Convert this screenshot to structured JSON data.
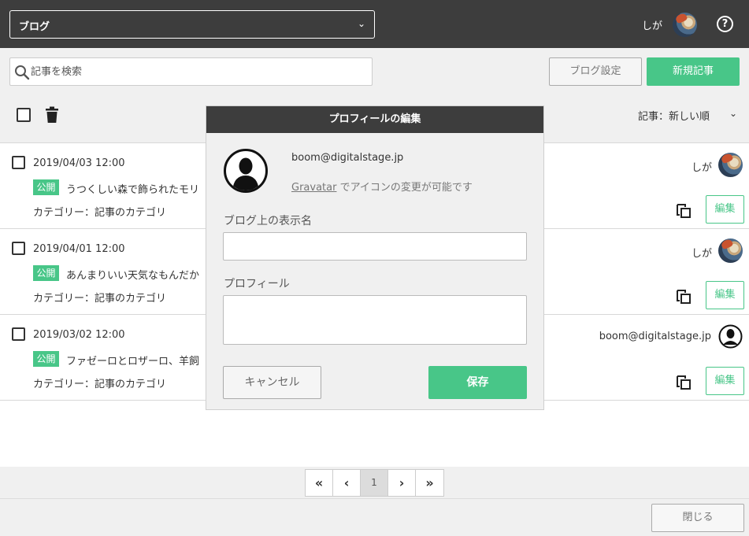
{
  "header": {
    "blog_select_value": "ブログ",
    "user_name": "しが",
    "help_label": "?"
  },
  "toolbar": {
    "search_placeholder": "記事を検索",
    "settings_label": "ブログ設定",
    "new_post_label": "新規記事",
    "sort_label": "記事：新しい順"
  },
  "posts": [
    {
      "date": "2019/04/03 12:00",
      "status": "公開",
      "title": "うつくしい森で飾られたモリ",
      "category": "カテゴリー：記事のカテゴリ",
      "author": "しが",
      "edit_label": "編集"
    },
    {
      "date": "2019/04/01 12:00",
      "status": "公開",
      "title": "あんまりいい天気なもんだか",
      "category": "カテゴリー：記事のカテゴリ",
      "author": "しが",
      "edit_label": "編集"
    },
    {
      "date": "2019/03/02 12:00",
      "status": "公開",
      "title": "ファゼーロとロザーロ、羊飼",
      "category": "カテゴリー：記事のカテゴリ",
      "author": "boom@digitalstage.jp",
      "edit_label": "編集"
    }
  ],
  "pagination": {
    "first": "«",
    "prev": "‹",
    "current": "1",
    "next": "›",
    "last": "»"
  },
  "footer": {
    "close_label": "閉じる"
  },
  "modal": {
    "title": "プロフィールの編集",
    "email": "boom@digitalstage.jp",
    "gravatar_link": "Gravatar",
    "gravatar_text": " でアイコンの変更が可能です",
    "display_name_label": "ブログ上の表示名",
    "display_name_value": "",
    "profile_label": "プロフィール",
    "profile_value": "",
    "cancel_label": "キャンセル",
    "save_label": "保存"
  },
  "colors": {
    "header_bg": "#3d3d3d",
    "accent_green": "#48c688",
    "panel_gray": "#f0f0f0"
  }
}
